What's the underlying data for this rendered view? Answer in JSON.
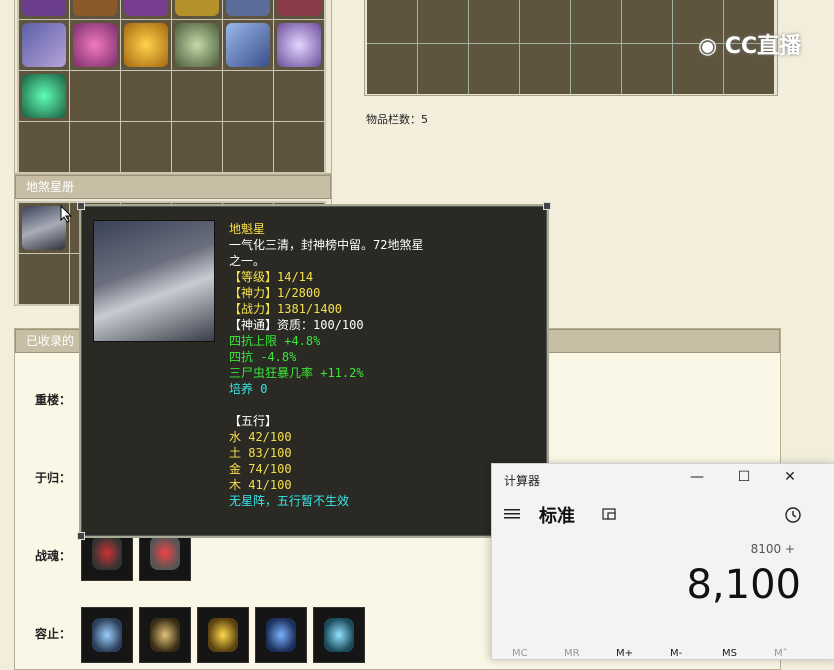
{
  "inventory": {
    "count_label": "物品栏数：5"
  },
  "star_book": {
    "header": "地煞星册"
  },
  "collected": {
    "header": "已收录的",
    "rows": [
      {
        "label": "重楼："
      },
      {
        "label": "于归："
      },
      {
        "label": "战魂："
      },
      {
        "label": "容止："
      }
    ]
  },
  "tooltip": {
    "name": "地魁星",
    "desc_line1": "一气化三清，封神榜中留。72地煞星",
    "desc_line2": "之一。",
    "level": "【等级】14/14",
    "divine_power": "【神力】1/2800",
    "combat": "【战力】1381/1400",
    "ability": "【神通】资质：100/100",
    "stat1": "四抗上限 +4.8%",
    "stat2": "四抗 -4.8%",
    "stat3": "三尸虫狂暴几率 +11.2%",
    "nurture": "培养 0",
    "five_elements_header": "【五行】",
    "water": "水 42/100",
    "earth": "土 83/100",
    "metal": "金 74/100",
    "wood": "木 41/100",
    "formation_note": "无星阵，五行暂不生效"
  },
  "calculator": {
    "title": "计算器",
    "mode": "标准",
    "expression": "8100 +",
    "display": "8,100",
    "minimize": "—",
    "maximize": "☐",
    "close": "✕",
    "mem_buttons": [
      "MC",
      "MR",
      "M+",
      "M-",
      "MS",
      "M˅"
    ]
  },
  "watermark": {
    "text": "CC直播"
  },
  "colors": {
    "tooltip_bg": "#2b2924",
    "yellow_text": "#f5e04a",
    "green_text": "#38e838",
    "cyan_text": "#39e6e6"
  }
}
